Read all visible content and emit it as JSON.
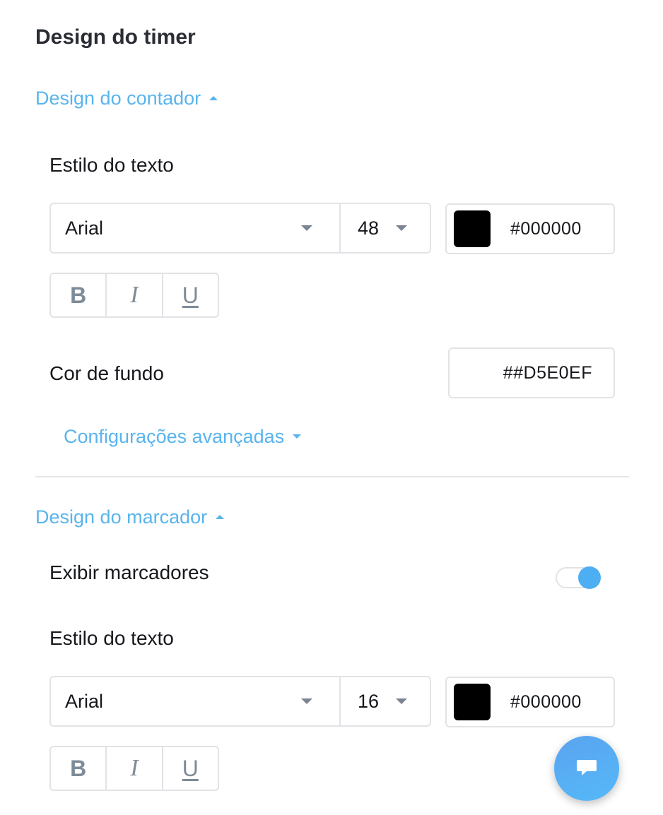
{
  "title": "Design do timer",
  "counter_section": {
    "toggle_label": "Design do contador",
    "text_style_label": "Estilo do texto",
    "font": "Arial",
    "font_size": "48",
    "text_color": "#000000",
    "text_color_swatch": "#000000",
    "style_buttons": {
      "bold": "B",
      "italic": "I",
      "underline": "U"
    },
    "bg_label": "Cor de fundo",
    "bg_color": "##D5E0EF",
    "advanced_label": "Configurações avançadas"
  },
  "marker_section": {
    "toggle_label": "Design do marcador",
    "show_markers_label": "Exibir marcadores",
    "show_markers_on": true,
    "text_style_label": "Estilo do texto",
    "font": "Arial",
    "font_size": "16",
    "text_color": "#000000",
    "text_color_swatch": "#000000",
    "style_buttons": {
      "bold": "B",
      "italic": "I",
      "underline": "U"
    }
  },
  "icons": {
    "section_expanded": "caret-up-icon",
    "section_collapsed": "caret-down-icon",
    "dropdown": "chevron-down-icon",
    "chat": "chat-bubble-icon"
  },
  "colors": {
    "accent": "#59b4ee",
    "toggle_on": "#4eaef4",
    "border": "#e1e3e6",
    "icon_gray": "#7e8b98"
  }
}
